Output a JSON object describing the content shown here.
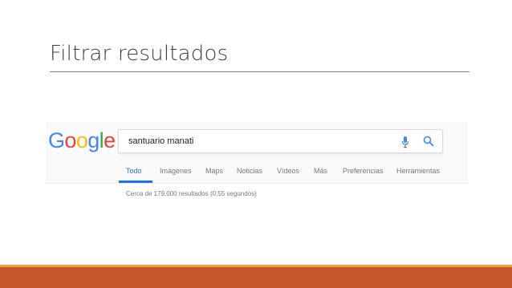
{
  "slide": {
    "title": "Filtrar resultados"
  },
  "logo": {
    "letters": [
      "G",
      "o",
      "o",
      "g",
      "l",
      "e"
    ],
    "colors": [
      "#4285F4",
      "#EA4335",
      "#FBBC05",
      "#4285F4",
      "#34A853",
      "#EA4335"
    ]
  },
  "search": {
    "value": "santuario manati",
    "mic_icon": "microphone-icon",
    "search_icon": "search-icon"
  },
  "tabs": [
    {
      "label": "Todo",
      "active": true
    },
    {
      "label": "Imágenes",
      "active": false
    },
    {
      "label": "Maps",
      "active": false
    },
    {
      "label": "Noticias",
      "active": false
    },
    {
      "label": "Vídeos",
      "active": false
    },
    {
      "label": "Más",
      "active": false
    },
    {
      "label": "Preferencias",
      "active": false
    },
    {
      "label": "Herramientas",
      "active": false
    }
  ],
  "results": {
    "stats": "Cerca de 179.000 resultados (0,55 segundos)"
  },
  "theme": {
    "accent": "#1a73e8",
    "footer_orange": "#c5572a",
    "footer_light": "#f0a04a"
  }
}
